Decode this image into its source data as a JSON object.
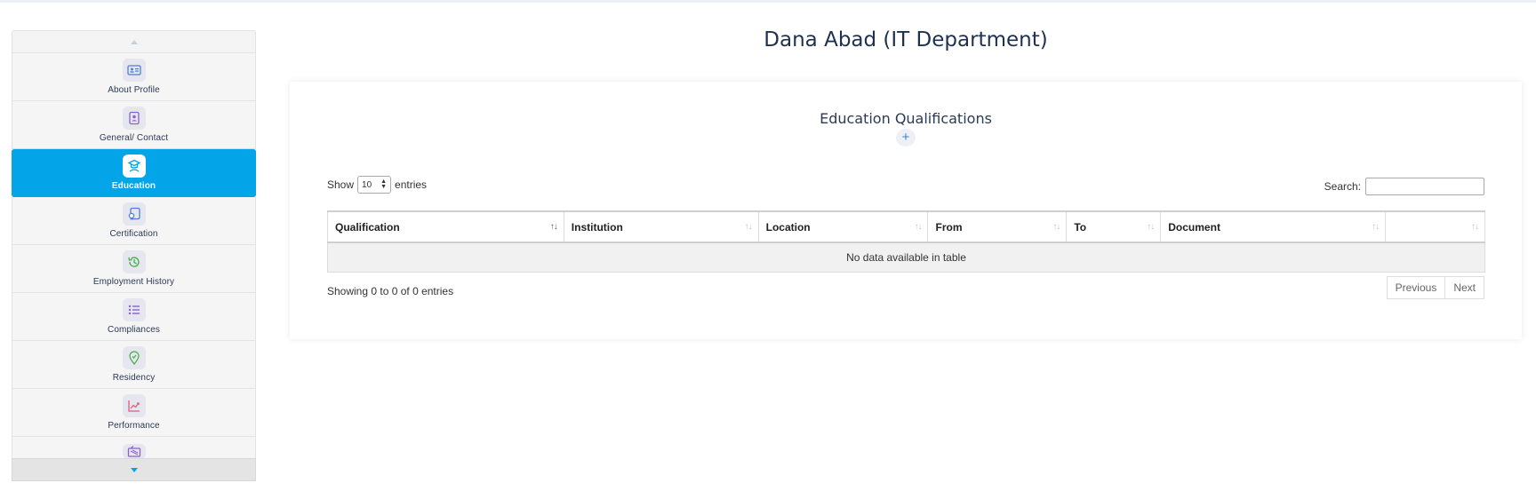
{
  "page": {
    "title": "Dana Abad (IT Department)"
  },
  "sidebar": {
    "items": [
      {
        "label": "About Profile",
        "icon": "id-card-icon",
        "color": "#4f7ddf"
      },
      {
        "label": "General/ Contact",
        "icon": "contact-card-icon",
        "color": "#8a63d2"
      },
      {
        "label": "Education",
        "icon": "graduation-icon",
        "color": "#03a4e8",
        "active": true
      },
      {
        "label": "Certification",
        "icon": "certificate-icon",
        "color": "#4f7ddf"
      },
      {
        "label": "Employment History",
        "icon": "history-icon",
        "color": "#4caf50"
      },
      {
        "label": "Compliances",
        "icon": "list-icon",
        "color": "#8a63d2"
      },
      {
        "label": "Residency",
        "icon": "location-pin-icon",
        "color": "#4caf50"
      },
      {
        "label": "Performance",
        "icon": "chart-icon",
        "color": "#e85a7a"
      },
      {
        "label": "",
        "icon": "ticket-icon",
        "color": "#8a63d2"
      }
    ]
  },
  "card": {
    "title": "Education Qualifications",
    "add_symbol": "+",
    "length": {
      "prefix": "Show",
      "value": "10",
      "suffix": "entries"
    },
    "search": {
      "label": "Search:",
      "value": ""
    },
    "columns": [
      "Qualification",
      "Institution",
      "Location",
      "From",
      "To",
      "Document",
      ""
    ],
    "empty_message": "No data available in table",
    "info": "Showing 0 to 0 of 0 entries",
    "pager": {
      "previous": "Previous",
      "next": "Next"
    }
  }
}
